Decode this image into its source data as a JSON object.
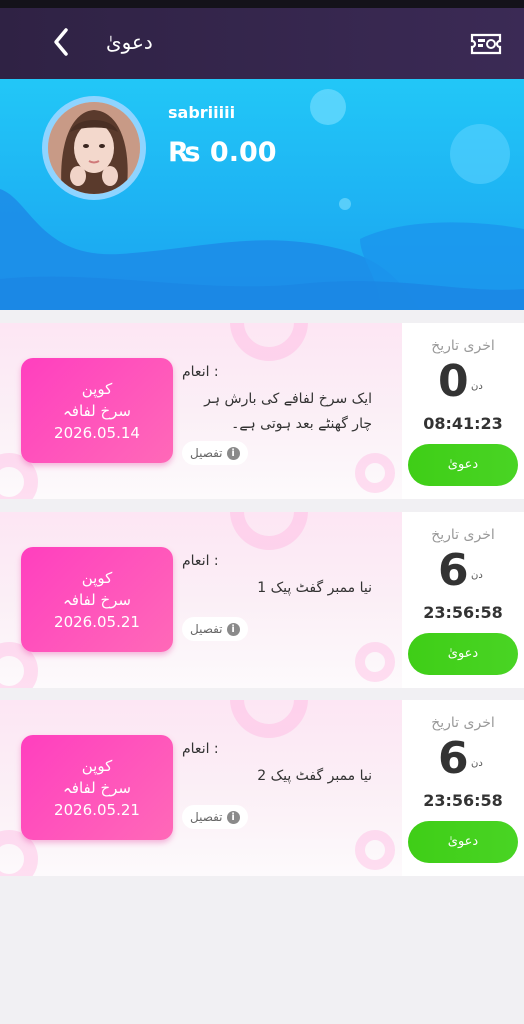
{
  "header": {
    "title": "دعویٰ",
    "back_icon": "chevron-left-icon",
    "ticket_icon": "ticket-icon"
  },
  "profile": {
    "username": "sabriiiii",
    "balance": "₨ 0.00"
  },
  "coupons": [
    {
      "type": "کوپن",
      "name": "سرخ لفافہ",
      "date": "2026.05.14",
      "reward_label": "انعام :",
      "reward_text": "ایک سرخ لفافے کی بارش ہر چار گھنٹے بعد ہوتی ہے۔",
      "detail": "تفصیل",
      "deadline_label": "اخری تاریخ",
      "days": "0",
      "days_unit": "دن",
      "time": "08:41:23",
      "claim": "دعویٰ"
    },
    {
      "type": "کوپن",
      "name": "سرخ لفافہ",
      "date": "2026.05.21",
      "reward_label": "انعام :",
      "reward_text": "نیا ممبر گفٹ پیک 1",
      "detail": "تفصیل",
      "deadline_label": "اخری تاریخ",
      "days": "6",
      "days_unit": "دن",
      "time": "23:56:58",
      "claim": "دعویٰ"
    },
    {
      "type": "کوپن",
      "name": "سرخ لفافہ",
      "date": "2026.05.21",
      "reward_label": "انعام :",
      "reward_text": "نیا ممبر گفٹ پیک 2",
      "detail": "تفصیل",
      "deadline_label": "اخری تاریخ",
      "days": "6",
      "days_unit": "دن",
      "time": "23:56:58",
      "claim": "دعویٰ"
    }
  ],
  "colors": {
    "header_bg": "#2f2244",
    "hero_blue": "#1aa2f0",
    "coupon_pink": "#ff3fbf",
    "claim_green": "#3fce17"
  }
}
